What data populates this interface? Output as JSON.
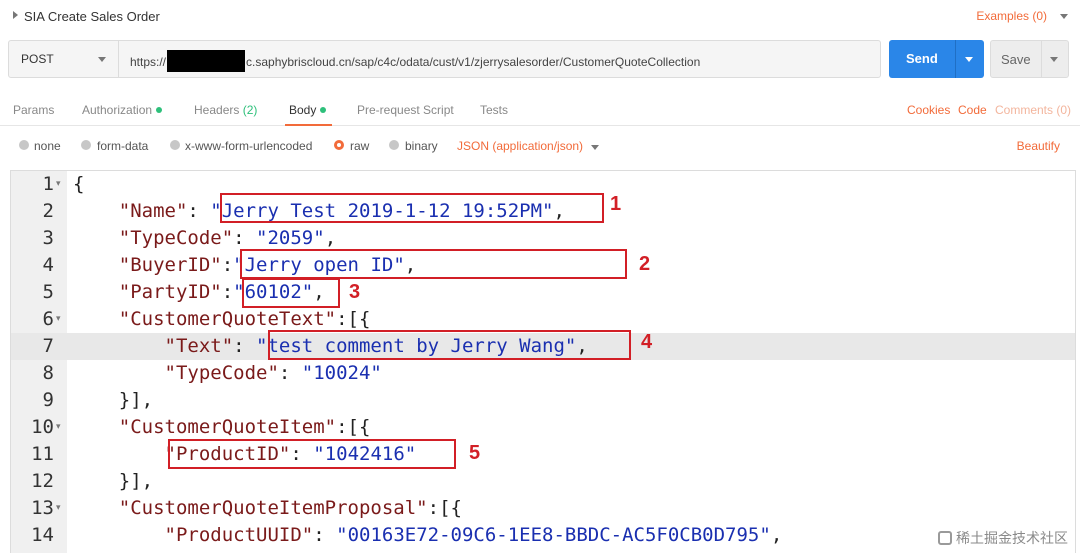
{
  "titlebar": {
    "title": "SIA Create Sales Order",
    "examples": "Examples (0)"
  },
  "request": {
    "method": "POST",
    "url_prefix": "https://",
    "url_suffix": "c.saphybriscloud.cn/sap/c4c/odata/cust/v1/zjerrysalesorder/CustomerQuoteCollection",
    "send_label": "Send",
    "save_label": "Save"
  },
  "tabs": {
    "params": "Params",
    "authorization": "Authorization",
    "headers": "Headers",
    "headers_count": "(2)",
    "body": "Body",
    "prerequest": "Pre-request Script",
    "tests": "Tests",
    "cookies": "Cookies",
    "code": "Code",
    "comments": "Comments (0)"
  },
  "body_types": {
    "none": "none",
    "form_data": "form-data",
    "urlencoded": "x-www-form-urlencoded",
    "raw": "raw",
    "binary": "binary",
    "json": "JSON (application/json)",
    "beautify": "Beautify"
  },
  "editor": {
    "lines": [
      {
        "n": "1",
        "fold": true,
        "code": [
          {
            "t": "{",
            "c": ""
          }
        ]
      },
      {
        "n": "2",
        "fold": false,
        "code": [
          {
            "t": "    ",
            "c": ""
          },
          {
            "t": "\"Name\"",
            "c": "k"
          },
          {
            "t": ": ",
            "c": ""
          },
          {
            "t": "\"Jerry Test 2019-1-12 19:52PM\"",
            "c": "s"
          },
          {
            "t": ",",
            "c": ""
          }
        ]
      },
      {
        "n": "3",
        "fold": false,
        "code": [
          {
            "t": "    ",
            "c": ""
          },
          {
            "t": "\"TypeCode\"",
            "c": "k"
          },
          {
            "t": ": ",
            "c": ""
          },
          {
            "t": "\"2059\"",
            "c": "s"
          },
          {
            "t": ",",
            "c": ""
          }
        ]
      },
      {
        "n": "4",
        "fold": false,
        "code": [
          {
            "t": "    ",
            "c": ""
          },
          {
            "t": "\"BuyerID\"",
            "c": "k"
          },
          {
            "t": ":",
            "c": ""
          },
          {
            "t": "\"Jerry open ID\"",
            "c": "s"
          },
          {
            "t": ",",
            "c": ""
          }
        ]
      },
      {
        "n": "5",
        "fold": false,
        "code": [
          {
            "t": "    ",
            "c": ""
          },
          {
            "t": "\"PartyID\"",
            "c": "k"
          },
          {
            "t": ":",
            "c": ""
          },
          {
            "t": "\"60102\"",
            "c": "s"
          },
          {
            "t": ",",
            "c": ""
          }
        ]
      },
      {
        "n": "6",
        "fold": true,
        "code": [
          {
            "t": "    ",
            "c": ""
          },
          {
            "t": "\"CustomerQuoteText\"",
            "c": "k"
          },
          {
            "t": ":[{",
            "c": ""
          }
        ]
      },
      {
        "n": "7",
        "fold": false,
        "code": [
          {
            "t": "        ",
            "c": ""
          },
          {
            "t": "\"Text\"",
            "c": "k"
          },
          {
            "t": ": ",
            "c": ""
          },
          {
            "t": "\"test comment by Jerry Wang\"",
            "c": "s"
          },
          {
            "t": ",",
            "c": ""
          }
        ]
      },
      {
        "n": "8",
        "fold": false,
        "code": [
          {
            "t": "        ",
            "c": ""
          },
          {
            "t": "\"TypeCode\"",
            "c": "k"
          },
          {
            "t": ": ",
            "c": ""
          },
          {
            "t": "\"10024\"",
            "c": "s"
          }
        ]
      },
      {
        "n": "9",
        "fold": false,
        "code": [
          {
            "t": "    }],",
            "c": ""
          }
        ]
      },
      {
        "n": "10",
        "fold": true,
        "code": [
          {
            "t": "    ",
            "c": ""
          },
          {
            "t": "\"CustomerQuoteItem\"",
            "c": "k"
          },
          {
            "t": ":[{",
            "c": ""
          }
        ]
      },
      {
        "n": "11",
        "fold": false,
        "code": [
          {
            "t": "        ",
            "c": ""
          },
          {
            "t": "\"ProductID\"",
            "c": "k"
          },
          {
            "t": ": ",
            "c": ""
          },
          {
            "t": "\"1042416\"",
            "c": "s"
          }
        ]
      },
      {
        "n": "12",
        "fold": false,
        "code": [
          {
            "t": "    }],",
            "c": ""
          }
        ]
      },
      {
        "n": "13",
        "fold": true,
        "code": [
          {
            "t": "    ",
            "c": ""
          },
          {
            "t": "\"CustomerQuoteItemProposal\"",
            "c": "k"
          },
          {
            "t": ":[{",
            "c": ""
          }
        ]
      },
      {
        "n": "14",
        "fold": false,
        "code": [
          {
            "t": "        ",
            "c": ""
          },
          {
            "t": "\"ProductUUID\"",
            "c": "k"
          },
          {
            "t": ": ",
            "c": ""
          },
          {
            "t": "\"00163E72-09C6-1EE8-BBDC-AC5F0CB0D795\"",
            "c": "s"
          },
          {
            "t": ",",
            "c": ""
          }
        ]
      }
    ],
    "highlighted_line": "7"
  },
  "annotations": {
    "markers": [
      "1",
      "2",
      "3",
      "4",
      "5"
    ],
    "color": "#d21f26"
  },
  "watermark": "稀土掘金技术社区",
  "colors": {
    "accent": "#f26b3a",
    "send": "#2a86e8",
    "annotation": "#d21f26"
  }
}
